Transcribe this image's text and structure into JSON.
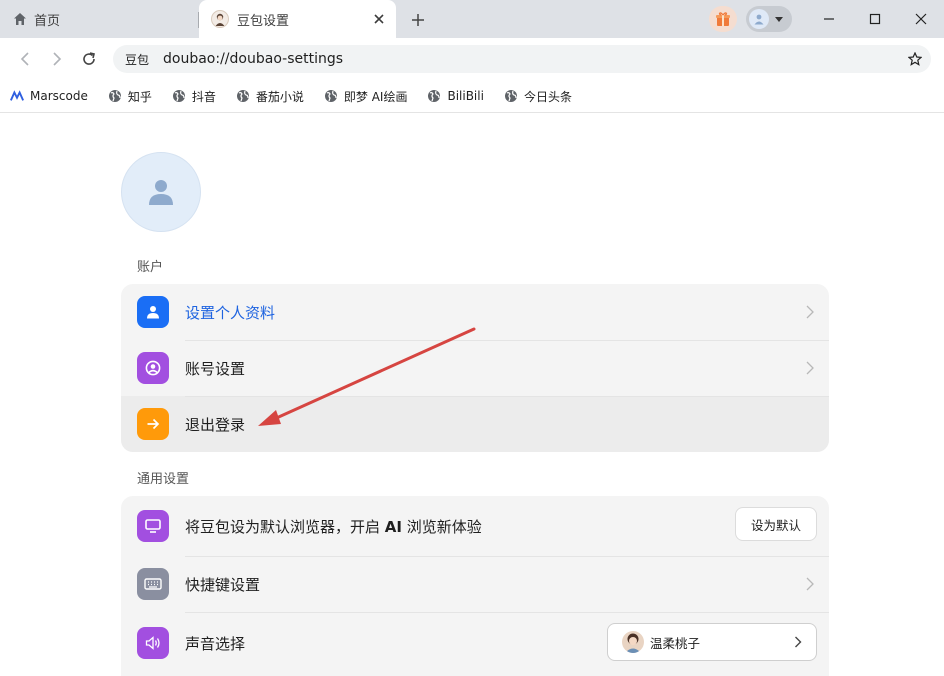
{
  "tabs": {
    "home_label": "首页",
    "active_label": "豆包设置"
  },
  "toolbar": {
    "site_chip": "豆包",
    "url": "doubao://doubao-settings"
  },
  "bookmarks": [
    {
      "label": "Marscode",
      "icon": "marscode-icon"
    },
    {
      "label": "知乎",
      "icon": "globe-icon"
    },
    {
      "label": "抖音",
      "icon": "globe-icon"
    },
    {
      "label": "番茄小说",
      "icon": "globe-icon"
    },
    {
      "label": "即梦 AI绘画",
      "icon": "globe-icon"
    },
    {
      "label": "BiliBili",
      "icon": "globe-icon"
    },
    {
      "label": "今日头条",
      "icon": "globe-icon"
    }
  ],
  "account": {
    "section_title": "账户",
    "items": [
      {
        "label": "设置个人资料",
        "icon": "user-icon",
        "color": "#1f64e0"
      },
      {
        "label": "账号设置",
        "icon": "account-circle-icon",
        "color": "#a24fe0"
      },
      {
        "label": "退出登录",
        "icon": "arrow-right-icon",
        "color": "#ff9a0a"
      }
    ]
  },
  "general": {
    "section_title": "通用设置",
    "default_browser": {
      "label_prefix": "将豆包设为默认浏览器，开启 ",
      "label_bold": "AI",
      "label_suffix": " 浏览新体验",
      "button": "设为默认"
    },
    "shortcuts": {
      "label": "快捷键设置"
    },
    "voice": {
      "label": "声音选择",
      "selected": "温柔桃子"
    }
  },
  "colors": {
    "accent_blue": "#1f64e0",
    "purple": "#a24fe0",
    "orange": "#ff9a0a",
    "gray_icon": "#8a8fa0",
    "annotation_arrow": "#d64541"
  }
}
